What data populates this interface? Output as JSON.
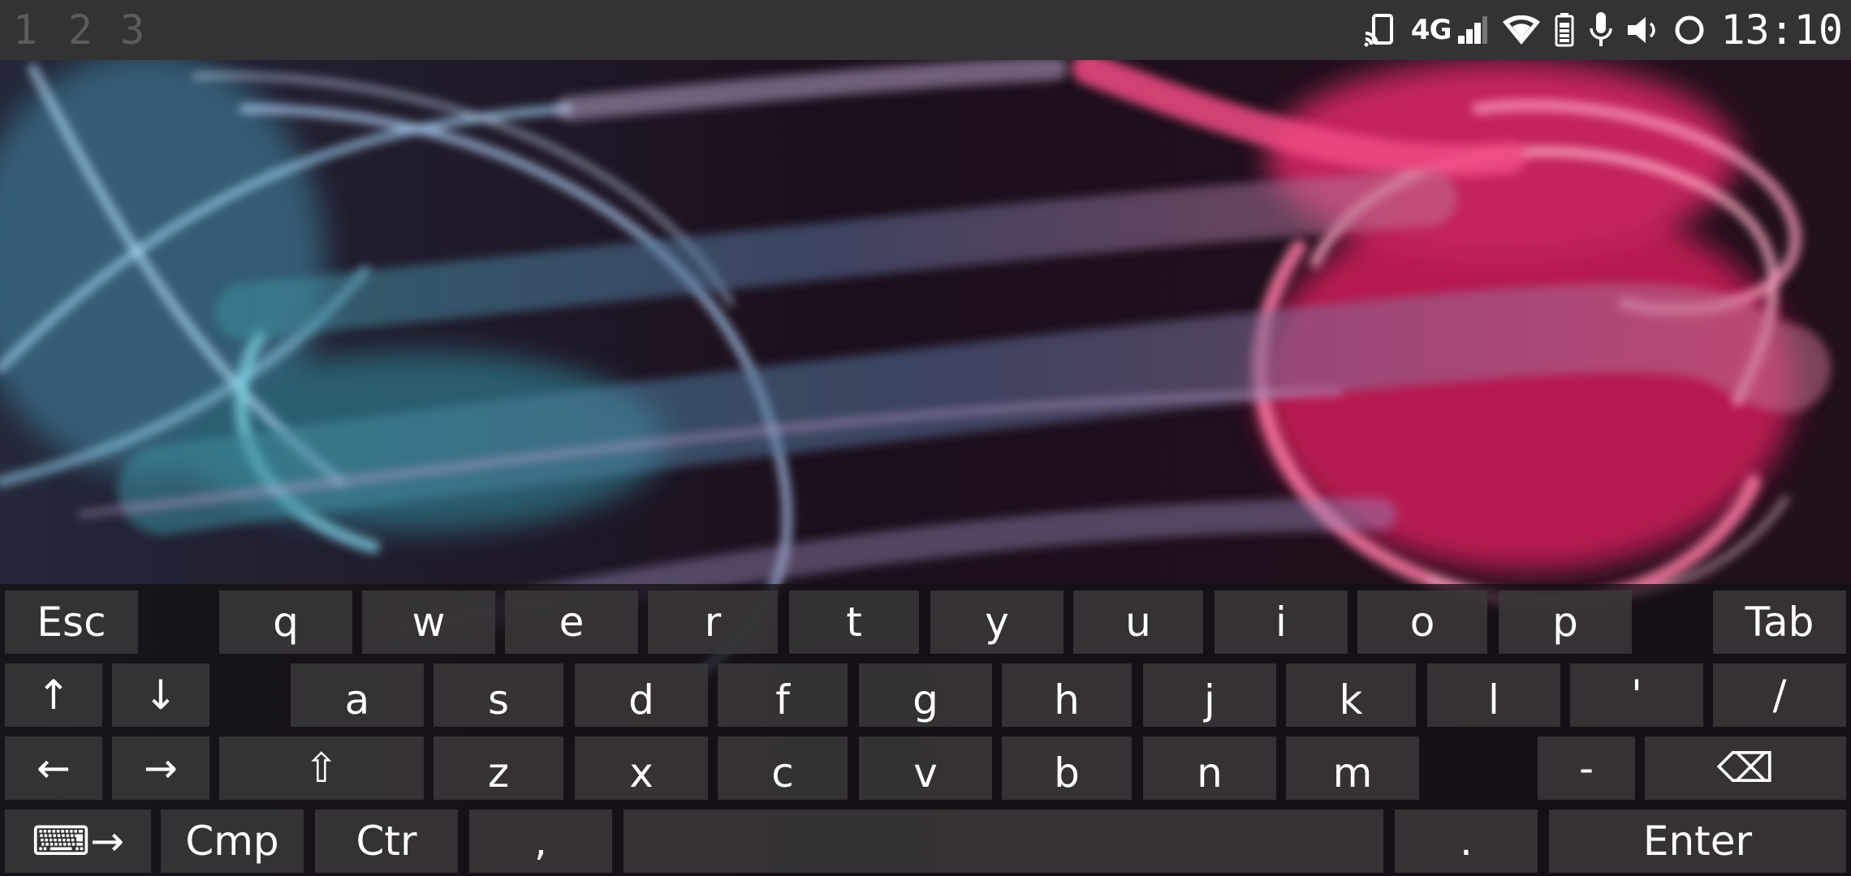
{
  "workspaces": [
    {
      "label": "1",
      "active": true
    },
    {
      "label": "2",
      "active": false
    },
    {
      "label": "3",
      "active": false
    }
  ],
  "status_bar": {
    "network_type": "4G",
    "clock": "13:10",
    "icons": [
      "cast-icon",
      "signal-icon",
      "wifi-icon",
      "battery-icon",
      "microphone-icon",
      "volume-icon",
      "circle-status-icon"
    ]
  },
  "keyboard": {
    "row1": [
      "Esc",
      "q",
      "w",
      "e",
      "r",
      "t",
      "y",
      "u",
      "i",
      "o",
      "p",
      "Tab"
    ],
    "row2": [
      "↑",
      "↓",
      "a",
      "s",
      "d",
      "f",
      "g",
      "h",
      "j",
      "k",
      "l",
      "'",
      "/"
    ],
    "row3": [
      "←",
      "→",
      "⇧",
      "z",
      "x",
      "c",
      "v",
      "b",
      "n",
      "m",
      "-",
      "⌫"
    ],
    "row4": [
      "⌨→",
      "Cmp",
      "Ctr",
      ",",
      "",
      ".",
      "Enter"
    ]
  },
  "colors": {
    "topbar": "#333333",
    "active_workspace": "#2a4b63",
    "wallpaper_pink": "#e8306e",
    "wallpaper_blue": "#8fc6e8"
  }
}
